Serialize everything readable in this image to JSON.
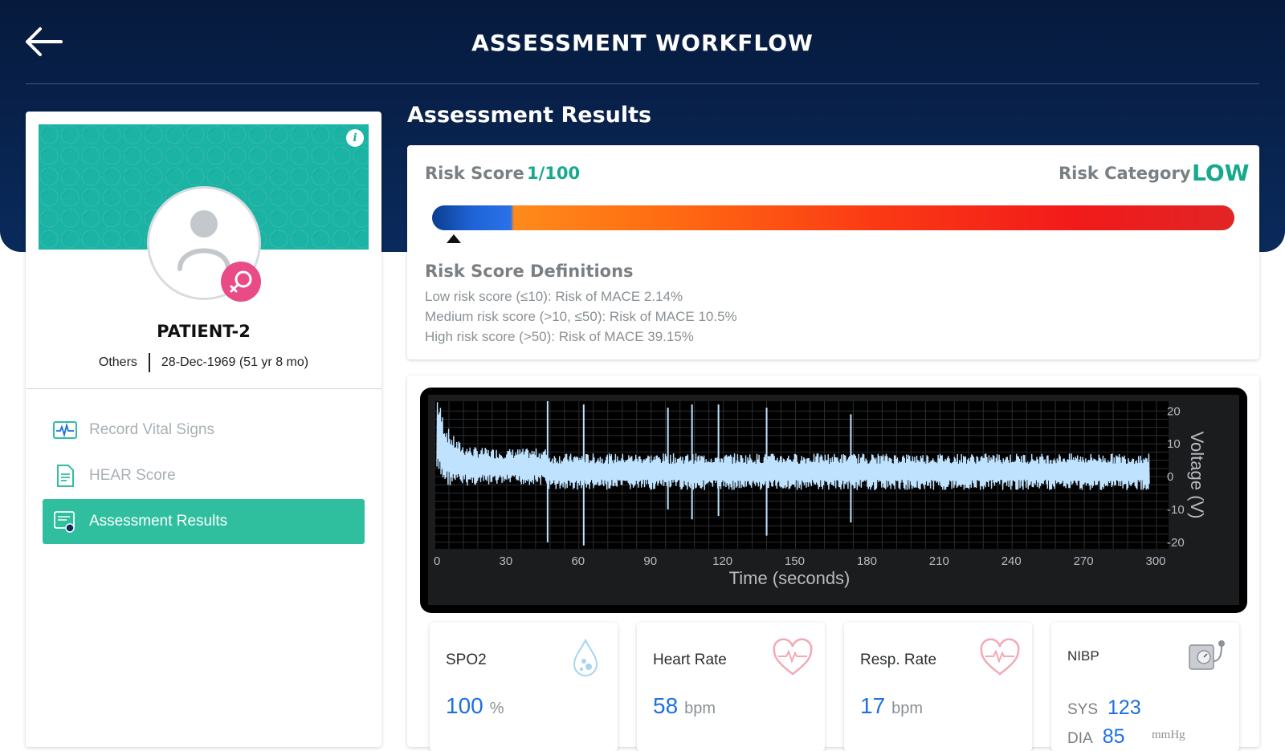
{
  "header": {
    "title": "ASSESSMENT WORKFLOW"
  },
  "patient": {
    "name": "PATIENT-2",
    "gender": "Others",
    "dob": "28-Dec-1969 (51 yr 8 mo)"
  },
  "nav": {
    "items": [
      {
        "label": "Record Vital Signs",
        "icon": "vital-monitor-icon",
        "active": false
      },
      {
        "label": "HEAR Score",
        "icon": "document-icon",
        "active": false
      },
      {
        "label": "Assessment Results",
        "icon": "results-icon",
        "active": true
      }
    ]
  },
  "main": {
    "section_title": "Assessment Results",
    "risk": {
      "score_label": "Risk Score",
      "score_value": "1/100",
      "score_fraction": 0.01,
      "category_label": "Risk Category",
      "category_value": "LOW",
      "definitions_title": "Risk Score Definitions",
      "definitions": [
        "Low risk score (≤10): Risk of MACE 2.14%",
        "Medium risk score (>10, ≤50): Risk of MACE 10.5%",
        "High risk score (>50): Risk of MACE 39.15%"
      ]
    }
  },
  "chart_data": {
    "type": "line",
    "xlabel": "Time (seconds)",
    "ylabel": "Voltage (V)",
    "xlim": [
      0,
      305
    ],
    "ylim": [
      -22,
      23
    ],
    "xticks": [
      0,
      30,
      60,
      90,
      120,
      150,
      180,
      210,
      240,
      270,
      300
    ],
    "yticks": [
      20,
      10,
      0,
      -10,
      -20
    ],
    "grid": true,
    "background": "#000000",
    "line_color": "#bfe3ff",
    "spikes": [
      {
        "x": 47,
        "y_top": 23,
        "y_bottom": -20
      },
      {
        "x": 62,
        "y_top": 22,
        "y_bottom": -21
      },
      {
        "x": 97,
        "y_top": 21,
        "y_bottom": -10
      },
      {
        "x": 107,
        "y_top": 22,
        "y_bottom": -13
      },
      {
        "x": 118,
        "y_top": 22,
        "y_bottom": -12
      },
      {
        "x": 138,
        "y_top": 21,
        "y_bottom": -18
      },
      {
        "x": 173,
        "y_top": 19,
        "y_bottom": -14
      }
    ]
  },
  "vitals": {
    "spo2": {
      "name": "SPO2",
      "value": "100",
      "unit": "%",
      "icon": "droplet-icon"
    },
    "heart_rate": {
      "name": "Heart Rate",
      "value": "58",
      "unit": "bpm",
      "icon": "heart-pulse-icon"
    },
    "resp_rate": {
      "name": "Resp. Rate",
      "value": "17",
      "unit": "bpm",
      "icon": "heart-pulse-icon"
    },
    "nibp": {
      "name": "NIBP",
      "sys_label": "SYS",
      "sys_value": "123",
      "dia_label": "DIA",
      "dia_value": "85",
      "unit": "mmHg",
      "icon": "bp-monitor-icon"
    }
  },
  "colors": {
    "header_bg": "#0a2a5c",
    "accent_green": "#17a98d",
    "nav_active": "#2fbf9f",
    "value_blue": "#1e6fe0",
    "female_badge": "#e94b86"
  }
}
